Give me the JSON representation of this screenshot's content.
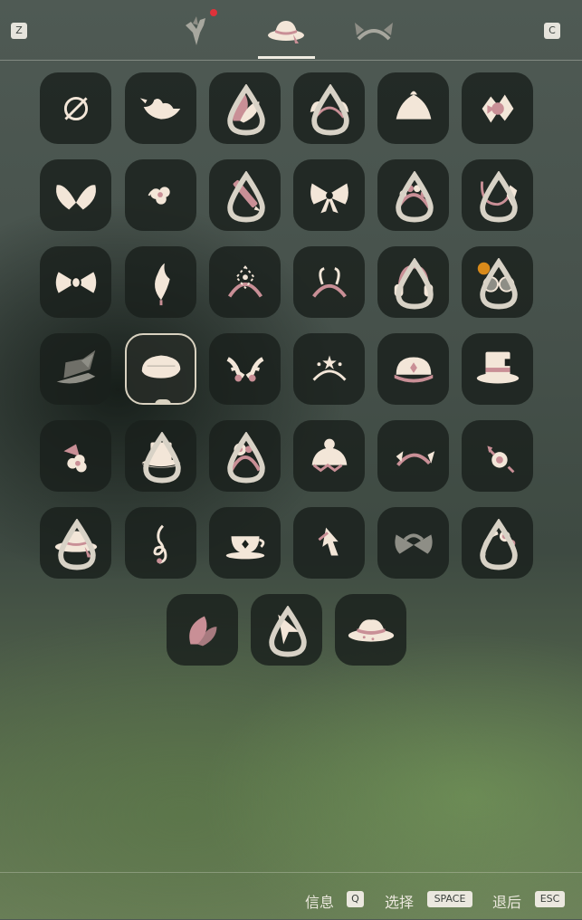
{
  "header": {
    "left_key": "Z",
    "right_key": "C",
    "tabs": [
      {
        "icon": "horn-icon",
        "notification": true
      },
      {
        "icon": "sunhat-icon",
        "selected": true
      },
      {
        "icon": "ears-icon"
      }
    ]
  },
  "grid": {
    "items": [
      {
        "icon": "none-icon",
        "drop": false
      },
      {
        "icon": "bird-icon",
        "drop": false
      },
      {
        "icon": "pink-leaf-icon",
        "drop": true
      },
      {
        "icon": "wing-headband-icon",
        "drop": true
      },
      {
        "icon": "bun-hair-icon",
        "drop": false
      },
      {
        "icon": "pink-bow-clip-icon",
        "drop": false
      },
      {
        "icon": "butterfly-bow-icon",
        "drop": false
      },
      {
        "icon": "small-flower-icon",
        "drop": false
      },
      {
        "icon": "pencil-icon",
        "drop": true
      },
      {
        "icon": "large-bow-icon",
        "drop": false
      },
      {
        "icon": "flower-crown-icon",
        "drop": true
      },
      {
        "icon": "leaf-headband-icon",
        "drop": true
      },
      {
        "icon": "bow-tie-icon",
        "drop": false
      },
      {
        "icon": "feather-icon",
        "drop": false
      },
      {
        "icon": "ornate-headband-icon",
        "drop": false
      },
      {
        "icon": "antenna-headband-icon",
        "drop": false
      },
      {
        "icon": "headphones-icon",
        "drop": true
      },
      {
        "icon": "goggles-icon",
        "drop": true
      },
      {
        "icon": "witch-hat-icon",
        "drop": false
      },
      {
        "icon": "beret-icon",
        "drop": false,
        "selected": true
      },
      {
        "icon": "antler-icon",
        "drop": false
      },
      {
        "icon": "tiara-icon",
        "drop": false
      },
      {
        "icon": "captain-cap-icon",
        "drop": false
      },
      {
        "icon": "top-hat-icon",
        "drop": false
      },
      {
        "icon": "flower-clip-icon",
        "drop": false
      },
      {
        "icon": "small-top-hat-icon",
        "drop": true
      },
      {
        "icon": "rose-headband-icon",
        "drop": true
      },
      {
        "icon": "bear-ears-icon",
        "drop": false
      },
      {
        "icon": "flower-headband-icon",
        "drop": false
      },
      {
        "icon": "rose-sprig-icon",
        "drop": false
      },
      {
        "icon": "sunhat-icon",
        "drop": true
      },
      {
        "icon": "treble-clef-icon",
        "drop": false
      },
      {
        "icon": "teacup-icon",
        "drop": false
      },
      {
        "icon": "arrow-hair-icon",
        "drop": false
      },
      {
        "icon": "grey-bow-icon",
        "drop": false
      },
      {
        "icon": "crescent-flower-icon",
        "drop": true
      },
      {
        "icon": "pink-petal-icon",
        "drop": false
      },
      {
        "icon": "cursor-icon",
        "drop": true
      },
      {
        "icon": "fedora-icon",
        "drop": false
      }
    ]
  },
  "footer": {
    "info_label": "信息",
    "info_key": "Q",
    "select_label": "选择",
    "select_key": "SPACE",
    "back_label": "退后",
    "back_key": "ESC"
  },
  "colors": {
    "cream": "#f3e6d8",
    "pink": "#c98f96",
    "slot_bg": "#1a201c",
    "notification": "#e0323a"
  }
}
